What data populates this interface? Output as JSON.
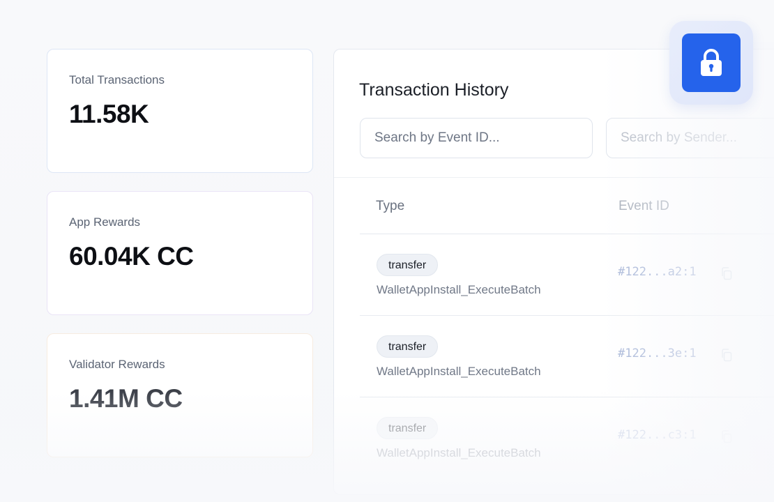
{
  "stats": [
    {
      "label": "Total Transactions",
      "value": "11.58K"
    },
    {
      "label": "App Rewards",
      "value": "60.04K CC"
    },
    {
      "label": "Validator Rewards",
      "value": "1.41M CC"
    }
  ],
  "transactions": {
    "title": "Transaction History",
    "search_event_placeholder": "Search by Event ID...",
    "search_sender_placeholder": "Search by Sender...",
    "columns": {
      "type": "Type",
      "event_id": "Event ID"
    },
    "rows": [
      {
        "badge": "transfer",
        "subtitle": "WalletAppInstall_ExecuteBatch",
        "event_id": "#122...a2:1"
      },
      {
        "badge": "transfer",
        "subtitle": "WalletAppInstall_ExecuteBatch",
        "event_id": "#122...3e:1"
      },
      {
        "badge": "transfer",
        "subtitle": "WalletAppInstall_ExecuteBatch",
        "event_id": "#122...c3:1"
      }
    ]
  },
  "icons": {
    "lock": "lock-icon",
    "copy": "copy-icon"
  },
  "colors": {
    "accent": "#2563eb",
    "lock_bg": "#e8edfb",
    "event_id": "#a5b4d6"
  }
}
